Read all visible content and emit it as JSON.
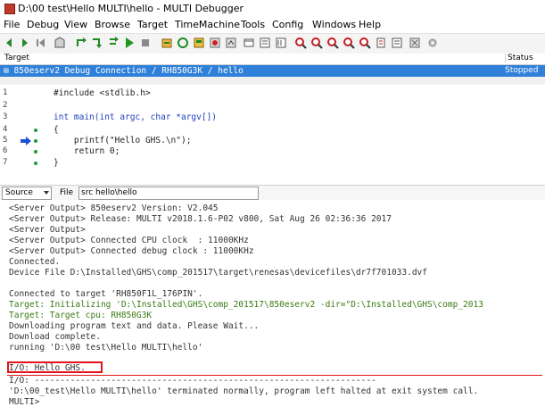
{
  "window": {
    "title": "D:\\00 test\\Hello MULTI\\hello - MULTI Debugger"
  },
  "menu": [
    "File",
    "Debug",
    "View",
    "Browse",
    "Target",
    "TimeMachine",
    "Tools",
    "Config",
    "Windows",
    "Help"
  ],
  "target_panel": {
    "col_target": "Target",
    "col_status": "Status",
    "connection": "⊞ 850eserv2 Debug Connection / RH850G3K / hello",
    "connection_status": "Stopped"
  },
  "source_lines": [
    {
      "num": "1",
      "code": "#include <stdlib.h>"
    },
    {
      "num": "2",
      "code": ""
    },
    {
      "num": "3",
      "code": "int main(int argc, char *argv[])"
    },
    {
      "num": "4",
      "code": "{"
    },
    {
      "num": "5",
      "code": "    printf(\"Hello GHS.\\n\");"
    },
    {
      "num": "6",
      "code": "    return 0;"
    },
    {
      "num": "7",
      "code": "}"
    }
  ],
  "bottom_tabs": {
    "source_label": "Source",
    "file_label": "File",
    "file_path": "src hello\\hello"
  },
  "console": {
    "lines": [
      "<Server Output> 850eserv2 Version: V2.045",
      "<Server Output> Release: MULTI v2018.1.6-P02 v800, Sat Aug 26 02:36:36 2017",
      "<Server Output>",
      "<Server Output> Connected CPU clock  : 11000KHz",
      "<Server Output> Connected debug clock : 11000KHz",
      "Connected.",
      "Device File D:\\Installed\\GHS\\comp_201517\\target\\renesas\\devicefiles\\dr7f701033.dvf",
      "",
      "Connected to target 'RH850F1L_176PIN'.",
      "Target: Initializing 'D:\\Installed\\GHS\\comp_201517\\850eserv2 -dir=\"D:\\Installed\\GHS\\comp_2013",
      "Target: Target cpu: RH850G3K",
      "Downloading program text and data. Please Wait...",
      "Download complete.",
      "running 'D:\\00 test\\Hello MULTI\\hello'",
      "I/O: Hello GHS.",
      "I/O: -------------------------------------------------------------------",
      "'D:\\00_test\\Hello MULTI\\hello' terminated normally, program left halted at exit system call.",
      "MULTI>"
    ]
  },
  "colors": {
    "selection": "#2f80d9",
    "highlight_box": "#e1161b",
    "green_text": "#3a7a13"
  }
}
